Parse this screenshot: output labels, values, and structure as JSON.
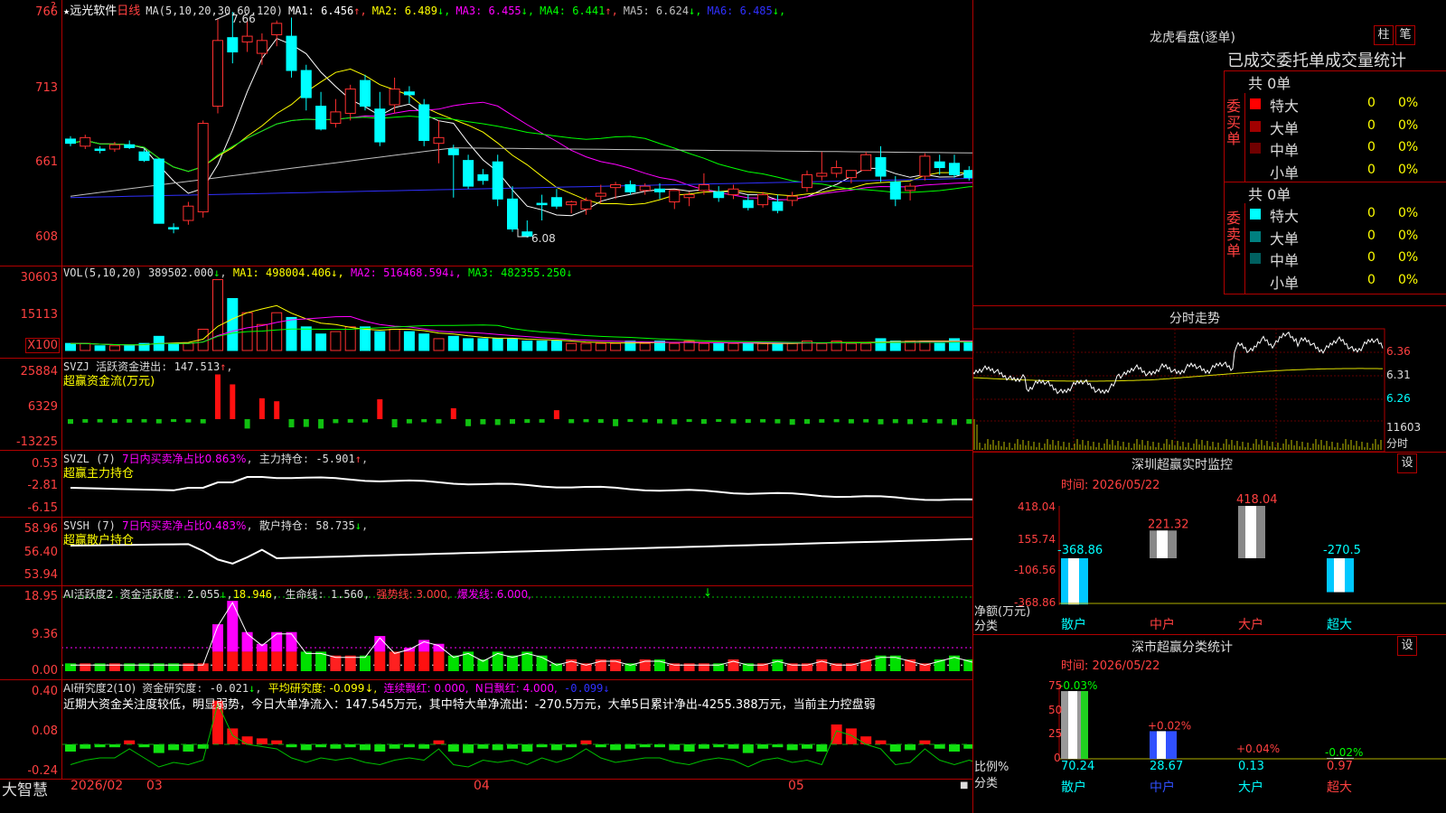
{
  "stock": {
    "name": "远光软件",
    "period": "日线",
    "star": "★"
  },
  "ma_header": {
    "label": "MA(5,10,20,30,60,120)",
    "items": [
      {
        "name": "MA1",
        "value": "6.456",
        "arrow": "↑",
        "color": "#ffffff"
      },
      {
        "name": "MA2",
        "value": "6.489",
        "arrow": "↓",
        "color": "#ffff00"
      },
      {
        "name": "MA3",
        "value": "6.455",
        "arrow": "↓",
        "color": "#ff00ff"
      },
      {
        "name": "MA4",
        "value": "6.441",
        "arrow": "↑",
        "color": "#00ff00"
      },
      {
        "name": "MA5",
        "value": "6.624",
        "arrow": "↓",
        "color": "#c0c0c0"
      },
      {
        "name": "MA6",
        "value": "6.485",
        "arrow": "↓",
        "color": "#3030ff"
      }
    ]
  },
  "price_axis": [
    "766",
    "713",
    "661",
    "608"
  ],
  "price_marks": {
    "high": "7.66",
    "low": "6.08"
  },
  "candles": [
    [
      6.77,
      6.79,
      6.72,
      6.74
    ],
    [
      6.72,
      6.8,
      6.7,
      6.78
    ],
    [
      6.7,
      6.72,
      6.67,
      6.69
    ],
    [
      6.7,
      6.75,
      6.68,
      6.73
    ],
    [
      6.73,
      6.76,
      6.7,
      6.71
    ],
    [
      6.68,
      6.7,
      6.61,
      6.62
    ],
    [
      6.63,
      6.63,
      6.18,
      6.18
    ],
    [
      6.15,
      6.18,
      6.11,
      6.14
    ],
    [
      6.2,
      6.33,
      6.17,
      6.3
    ],
    [
      6.26,
      6.9,
      6.22,
      6.88
    ],
    [
      7.0,
      7.61,
      6.95,
      7.46
    ],
    [
      7.48,
      7.66,
      7.3,
      7.38
    ],
    [
      7.45,
      7.6,
      7.38,
      7.49
    ],
    [
      7.37,
      7.51,
      7.29,
      7.46
    ],
    [
      7.5,
      7.6,
      7.42,
      7.58
    ],
    [
      7.49,
      7.62,
      7.2,
      7.25
    ],
    [
      7.25,
      7.29,
      6.97,
      7.06
    ],
    [
      7.0,
      7.1,
      6.83,
      6.84
    ],
    [
      6.88,
      7.05,
      6.85,
      6.96
    ],
    [
      6.95,
      7.15,
      6.9,
      7.12
    ],
    [
      7.18,
      7.22,
      6.97,
      7.0
    ],
    [
      6.98,
      7.1,
      6.72,
      6.75
    ],
    [
      7.01,
      7.2,
      6.95,
      7.12
    ],
    [
      7.1,
      7.14,
      7.02,
      7.08
    ],
    [
      7.01,
      7.05,
      6.72,
      6.76
    ],
    [
      6.74,
      6.9,
      6.6,
      6.78
    ],
    [
      6.7,
      6.73,
      6.36,
      6.66
    ],
    [
      6.62,
      6.66,
      6.42,
      6.44
    ],
    [
      6.52,
      6.56,
      6.45,
      6.48
    ],
    [
      6.61,
      6.66,
      6.3,
      6.35
    ],
    [
      6.35,
      6.44,
      6.12,
      6.14
    ],
    [
      6.12,
      6.2,
      6.08,
      6.09
    ],
    [
      6.32,
      6.38,
      6.2,
      6.31
    ],
    [
      6.36,
      6.42,
      6.28,
      6.3
    ],
    [
      6.31,
      6.34,
      6.25,
      6.33
    ],
    [
      6.28,
      6.36,
      6.24,
      6.34
    ],
    [
      6.37,
      6.45,
      6.32,
      6.39
    ],
    [
      6.43,
      6.47,
      6.35,
      6.45
    ],
    [
      6.45,
      6.48,
      6.38,
      6.4
    ],
    [
      6.41,
      6.46,
      6.38,
      6.44
    ],
    [
      6.42,
      6.46,
      6.35,
      6.4
    ],
    [
      6.33,
      6.41,
      6.28,
      6.41
    ],
    [
      6.36,
      6.4,
      6.3,
      6.38
    ],
    [
      6.41,
      6.53,
      6.38,
      6.45
    ],
    [
      6.4,
      6.44,
      6.33,
      6.36
    ],
    [
      6.38,
      6.45,
      6.35,
      6.42
    ],
    [
      6.34,
      6.38,
      6.27,
      6.29
    ],
    [
      6.31,
      6.4,
      6.29,
      6.38
    ],
    [
      6.33,
      6.38,
      6.25,
      6.27
    ],
    [
      6.34,
      6.4,
      6.3,
      6.37
    ],
    [
      6.43,
      6.55,
      6.4,
      6.52
    ],
    [
      6.51,
      6.68,
      6.48,
      6.53
    ],
    [
      6.53,
      6.62,
      6.5,
      6.57
    ],
    [
      6.5,
      6.55,
      6.46,
      6.55
    ],
    [
      6.55,
      6.68,
      6.55,
      6.66
    ],
    [
      6.64,
      6.72,
      6.47,
      6.51
    ],
    [
      6.47,
      6.51,
      6.3,
      6.35
    ],
    [
      6.41,
      6.46,
      6.34,
      6.44
    ],
    [
      6.51,
      6.67,
      6.48,
      6.65
    ],
    [
      6.61,
      6.66,
      6.52,
      6.57
    ],
    [
      6.6,
      6.66,
      6.5,
      6.52
    ],
    [
      6.55,
      6.58,
      6.48,
      6.5
    ],
    [
      6.46,
      6.5,
      6.31,
      6.4
    ]
  ],
  "vol_header": {
    "label": "VOL(5,10,20)",
    "value": "389502.000",
    "ma1": "498004.406",
    "ma2": "516468.594",
    "ma3": "482355.250"
  },
  "vol_axis": [
    "30603",
    "15113",
    "X100"
  ],
  "volume": [
    3,
    3,
    2,
    2,
    2,
    3,
    6,
    3,
    3,
    9,
    30,
    22,
    16,
    11,
    16,
    14,
    10,
    7,
    8,
    10,
    10,
    8,
    9,
    8,
    7,
    5,
    6,
    5,
    5,
    5,
    5,
    4,
    4,
    4,
    3,
    3,
    3,
    3,
    4,
    3,
    4,
    3,
    4,
    3,
    3,
    3,
    3,
    3,
    3,
    3,
    4,
    3,
    4,
    3,
    3,
    5,
    4,
    4,
    4,
    3,
    5,
    4,
    3
  ],
  "svzj": {
    "label": "SVZJ",
    "name": "活跃资金进出",
    "value": "147.513",
    "arrow": "↑",
    "sub": "超赢资金流(万元)",
    "axis": [
      "25884",
      "6329",
      "-13225"
    ]
  },
  "svzj_vals": [
    -20,
    -15,
    -14,
    -16,
    -15,
    -14,
    -18,
    -12,
    -14,
    -18,
    90,
    70,
    -40,
    42,
    36,
    -35,
    -33,
    -40,
    -17,
    -15,
    -14,
    40,
    -35,
    -18,
    -13,
    -18,
    22,
    -30,
    -22,
    -25,
    -20,
    -16,
    -15,
    18,
    -17,
    -13,
    -16,
    -30,
    -12,
    -14,
    -18,
    -22,
    -12,
    -20,
    -10,
    -18,
    -16,
    -14,
    -18,
    -24,
    -20,
    -15,
    -13,
    -18,
    -14,
    -22,
    -17,
    -21,
    -15,
    -18,
    -25,
    -20,
    -14
  ],
  "svzl": {
    "label": "SVZL (7)",
    "name": "7日内买卖净占比",
    "pct": "0.863%",
    "main": "主力持仓",
    "value": "-5.901",
    "arrow": "↑",
    "sub": "超赢主力持仓",
    "axis": [
      "0.53",
      "-2.81",
      "-6.15"
    ]
  },
  "svsh": {
    "label": "SVSH (7)",
    "name": "7日内买卖净占比",
    "pct": "0.483%",
    "main": "散户持仓",
    "value": "58.735",
    "arrow": "↓",
    "sub": "超赢散户持仓",
    "axis": [
      "58.96",
      "56.40",
      "53.94"
    ]
  },
  "ai1": {
    "label": "AI活跃度2",
    "name": "资金活跃度",
    "value": "2.055",
    "v2": "18.946",
    "life": "生命线",
    "life_v": "1.560",
    "strong": "强势线",
    "strong_v": "3.000",
    "burst": "爆发线",
    "burst_v": "6.000",
    "axis": [
      "18.95",
      "9.36",
      "0.00"
    ]
  },
  "ai1_vals": [
    2,
    2,
    2,
    2,
    2,
    2,
    2,
    2,
    2,
    2,
    12,
    18,
    10,
    7,
    10,
    10,
    5,
    5,
    4,
    4,
    4,
    9,
    5,
    6,
    8,
    7,
    4,
    5,
    3,
    5,
    4,
    5,
    4,
    2,
    3,
    2,
    3,
    3,
    2,
    3,
    3,
    2,
    2,
    2,
    2,
    3,
    2,
    2,
    3,
    2,
    2,
    3,
    2,
    2,
    3,
    4,
    4,
    3,
    2,
    3,
    4,
    3,
    2
  ],
  "ai2": {
    "label": "AI研究度2(10)",
    "name": "资金研究度",
    "value": "-0.021",
    "avg": "平均研究度",
    "avg_v": "-0.099",
    "red": "连续飘红",
    "red_v": "0.000",
    "nred": "N日飘红",
    "nred_v": "4.000",
    "last": "-0.099",
    "axis": [
      "0.40",
      "0.08",
      "-0.24"
    ],
    "comment": "近期大资金关注度较低，明显弱势，今日大单净流入：147.545万元，其中特大单净流出：-270.5万元，大单5日累计净出-4255.388万元，当前主力控盘弱"
  },
  "ai2_vals": [
    -5,
    -3,
    -2,
    -2,
    2,
    -2,
    -6,
    -4,
    -5,
    -3,
    22,
    8,
    4,
    3,
    2,
    -2,
    -4,
    -2,
    -3,
    -2,
    -4,
    -5,
    -3,
    -2,
    -3,
    2,
    -5,
    -6,
    -3,
    -4,
    -3,
    -5,
    -2,
    -4,
    -2,
    2,
    -2,
    -4,
    -3,
    -2,
    -2,
    -4,
    -5,
    -3,
    -2,
    -3,
    -6,
    -3,
    -2,
    -4,
    -3,
    -5,
    10,
    8,
    4,
    2,
    -5,
    -4,
    2,
    -3,
    -5,
    -3,
    -5
  ],
  "date_axis": {
    "bottom_left": "大智慧",
    "labels": [
      "2026/02",
      "03",
      "04",
      "05"
    ]
  },
  "lhkp": {
    "title": "龙虎看盘(逐单)",
    "btn1": "柱",
    "btn2": "笔",
    "subtitle": "已成交委托单成交量统计",
    "buy_label": "委买单",
    "sell_label": "委卖单",
    "buy_total": "共 0单",
    "sell_total": "共 0单",
    "buy_rows": [
      {
        "name": "特大",
        "v": "0",
        "p": "0%",
        "color": "#ff0000"
      },
      {
        "name": "大单",
        "v": "0",
        "p": "0%",
        "color": "#a00000"
      },
      {
        "name": "中单",
        "v": "0",
        "p": "0%",
        "color": "#700000"
      },
      {
        "name": "小单",
        "v": "0",
        "p": "0%",
        "color": ""
      }
    ],
    "sell_rows": [
      {
        "name": "特大",
        "v": "0",
        "p": "0%",
        "color": "#00ffff"
      },
      {
        "name": "大单",
        "v": "0",
        "p": "0%",
        "color": "#008080"
      },
      {
        "name": "中单",
        "v": "0",
        "p": "0%",
        "color": "#006060"
      },
      {
        "name": "小单",
        "v": "0",
        "p": "0%",
        "color": ""
      }
    ]
  },
  "fenshi": {
    "title": "分时走势",
    "axis": [
      "6.36",
      "6.31",
      "6.26"
    ],
    "vol_label": "11603",
    "time_label": "分时"
  },
  "szcy": {
    "title": "深圳超赢实时监控",
    "btn": "设",
    "time": "时间: 2026/05/22",
    "axis": [
      "418.04",
      "155.74",
      "-106.56",
      "-368.86"
    ],
    "bars": [
      {
        "name": "散户",
        "value": "-368.86",
        "v": -368.86,
        "name_color": "#00ffff"
      },
      {
        "name": "中户",
        "value": "221.32",
        "v": 221.32,
        "name_color": "#ff4040"
      },
      {
        "name": "大户",
        "value": "418.04",
        "v": 418.04,
        "name_color": "#ff4040"
      },
      {
        "name": "超大",
        "value": "-270.5",
        "v": -270.5,
        "name_color": "#00ffff"
      }
    ],
    "ylabel": "净额(万元)",
    "xlabel": "分类"
  },
  "scfl": {
    "title": "深市超赢分类统计",
    "btn": "设",
    "time": "时间: 2026/05/22",
    "axis": [
      "75",
      "50",
      "25",
      "0"
    ],
    "bars": [
      {
        "name": "散户",
        "top": "-0.03%",
        "bottom": "70.24",
        "v": 70.24
      },
      {
        "name": "中户",
        "top": "+0.02%",
        "bottom": "28.67",
        "v": 28.67
      },
      {
        "name": "大户",
        "top": "+0.04%",
        "bottom": "0.13",
        "v": 0.13
      },
      {
        "name": "超大",
        "top": "-0.02%",
        "bottom": "0.97",
        "v": 0.97
      }
    ],
    "ylabel": "比例%",
    "xlabel": "分类"
  }
}
